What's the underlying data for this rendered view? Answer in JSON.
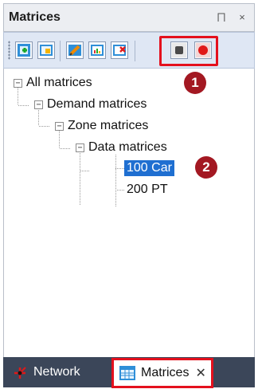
{
  "panel": {
    "title": "Matrices",
    "pin_glyph": "⨅",
    "close_glyph": "×"
  },
  "toolbar": {
    "buttons": [
      {
        "name": "add-matrix-icon"
      },
      {
        "name": "open-matrix-icon"
      },
      {
        "name": "edit-matrix-icon"
      },
      {
        "name": "chart-icon"
      },
      {
        "name": "delete-matrix-icon"
      },
      {
        "name": "stop-icon"
      },
      {
        "name": "record-icon"
      }
    ]
  },
  "tree": {
    "root": "All matrices",
    "demand": "Demand matrices",
    "zone": "Zone matrices",
    "data": "Data matrices",
    "item1": "100 Car",
    "item2": "200 PT",
    "expander_glyph": "−"
  },
  "callouts": {
    "one": "1",
    "two": "2"
  },
  "tabs": {
    "network": "Network",
    "matrices": "Matrices",
    "close_glyph": "✕"
  },
  "colors": {
    "highlight": "#e4101d",
    "selection": "#1f6fd1",
    "badge": "#a31822",
    "tab_strip": "#3b4659"
  }
}
